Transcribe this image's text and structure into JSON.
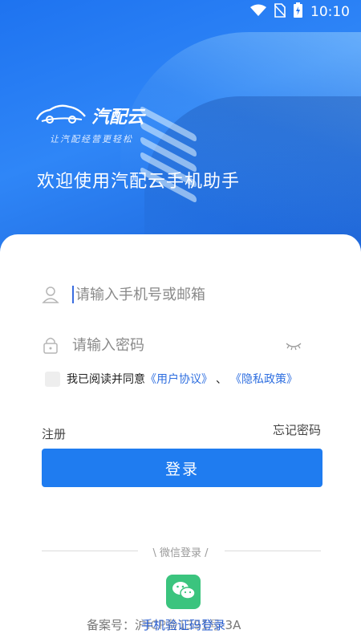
{
  "status_bar": {
    "time": "10:10"
  },
  "header": {
    "brand_name": "汽配云",
    "slogan": "让汽配经营更轻松",
    "welcome": "欢迎使用汽配云手机助手"
  },
  "login_form": {
    "account_placeholder": "请输入手机号或邮箱",
    "password_placeholder": "请输入密码",
    "agree_prefix": "我已阅读并同意",
    "user_agreement": "《用户协议》",
    "separator": "、",
    "privacy_policy": "《隐私政策》",
    "register_label": "注册",
    "forgot_label": "忘记密码",
    "login_label": "登录"
  },
  "third_party": {
    "wechat_label": "\\ 微信登录 /"
  },
  "footer": {
    "beian_text": "备案号：沪ICP备1391号-3A",
    "phone_login_label": "手机验证码登录"
  },
  "colors": {
    "brand_blue": "#1f7cf0",
    "link_blue": "#2f6fe0",
    "wechat_green": "#3bc47e"
  },
  "icons": [
    "wifi-icon",
    "no-sim-icon",
    "battery-charging-icon",
    "car-logo-icon",
    "user-icon",
    "lock-icon",
    "eye-closed-icon",
    "wechat-icon"
  ]
}
